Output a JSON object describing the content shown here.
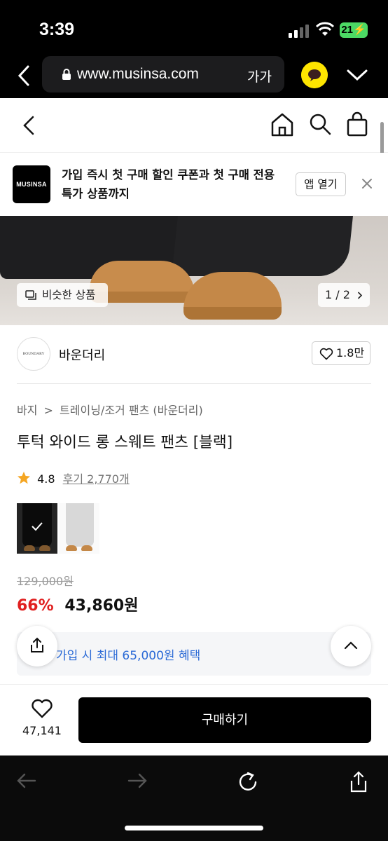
{
  "status": {
    "time": "3:39",
    "battery": "21"
  },
  "browser": {
    "url": "www.musinsa.com",
    "text_size": "가가"
  },
  "promo": {
    "logo_text": "MUSINSA",
    "message": "가입 즉시 첫 구매 할인 쿠폰과 첫 구매 전용 특가 상품까지",
    "open_label": "앱 열기"
  },
  "hero": {
    "similar_label": "비슷한 상품",
    "pager": "1 / 2"
  },
  "brand": {
    "logo_text": "BOUNDARY",
    "name": "바운더리",
    "likes": "1.8만"
  },
  "breadcrumb": [
    "바지",
    ">",
    "트레이닝/조거 팬츠 (바운더리)"
  ],
  "product": {
    "title": "투턱 와이드 롱 스웨트 팬츠 [블랙]",
    "rating": "4.8",
    "reviews": "후기 2,770개",
    "original_price": "129,000원",
    "discount": "66%",
    "price": "43,860원",
    "benefit": "가입 시 최대 65,000원 혜택"
  },
  "buybar": {
    "like_count": "47,141",
    "buy_label": "구매하기"
  },
  "colors": {
    "accent_red": "#e02020",
    "benefit_blue": "#2b6ad6",
    "star": "#f5a623"
  }
}
